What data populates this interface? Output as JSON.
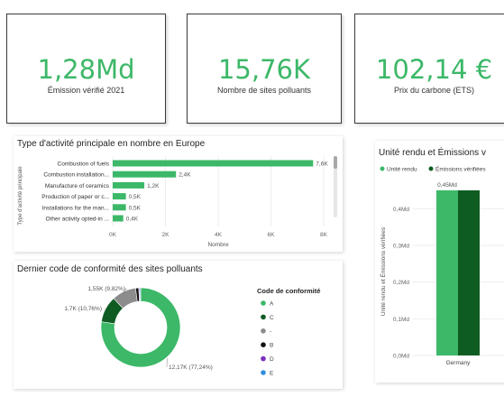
{
  "colors": {
    "accent": "#3cb868",
    "kpi_value": "#3cb868",
    "bar": "#3cb868",
    "dark_green": "#0f5c23"
  },
  "kpis": [
    {
      "value": "1,28Md",
      "label": "Émission vérifié 2021"
    },
    {
      "value": "15,76K",
      "label": "Nombre de sites polluants"
    },
    {
      "value": "102,14 €",
      "label": "Prix du carbone (ETS)"
    }
  ],
  "activity_panel": {
    "title": "Type d'activité principale en nombre en Europe",
    "chart_data": {
      "type": "bar",
      "orientation": "horizontal",
      "categories": [
        "Combustion of fuels",
        "Combustion installation...",
        "Manufacture of ceramics",
        "Production of paper or c...",
        "Installations for the man...",
        "Other activity opted-in ..."
      ],
      "values": [
        7600,
        2400,
        1200,
        500,
        500,
        400
      ],
      "data_labels": [
        "7,6K",
        "2,4K",
        "1,2K",
        "0,5K",
        "0,5K",
        "0,4K"
      ],
      "xticks": [
        "0K",
        "2K",
        "4K",
        "6K",
        "8K"
      ],
      "xlim": [
        0,
        8000
      ],
      "xlabel": "Nombre",
      "ylabel": "Type d'activité principale",
      "grid": true
    }
  },
  "compliance_panel": {
    "title": "Dernier code de conformité des sites polluants",
    "legend_title": "Code de conformité",
    "chart_data": {
      "type": "pie",
      "style": "donut",
      "categories": [
        "A",
        "C",
        "-",
        "B",
        "D",
        "E"
      ],
      "values": [
        12170,
        1700,
        1550,
        200,
        60,
        60
      ],
      "colors": [
        "#3cb868",
        "#0f5c23",
        "#8c8c8c",
        "#111111",
        "#7b2fbf",
        "#2f8fe0"
      ],
      "data_labels": [
        "12,17K (77,24%)",
        "1,7K (10,76%)",
        "1,55K (9,82%)"
      ],
      "legend_position": "right"
    }
  },
  "emissions_panel": {
    "title": "Unité rendu et Émissions v",
    "legend": [
      "Unité rendu",
      "Émissions vérifiées"
    ],
    "chart_data": {
      "type": "bar",
      "categories": [
        "Germany"
      ],
      "series": [
        {
          "name": "Unité rendu",
          "values": [
            0.45
          ],
          "color": "#3cb868"
        },
        {
          "name": "Émissions vérifiées",
          "values": [
            0.45
          ],
          "color": "#0f5c23"
        }
      ],
      "data_labels": [
        "0,45Md"
      ],
      "yticks": [
        "0,0Md",
        "0,1Md",
        "0,2Md",
        "0,3Md",
        "0,4Md"
      ],
      "ylim": [
        0,
        0.45
      ],
      "ylabel": "Unité rendu et Émissions vérifiées",
      "grid": true
    }
  }
}
